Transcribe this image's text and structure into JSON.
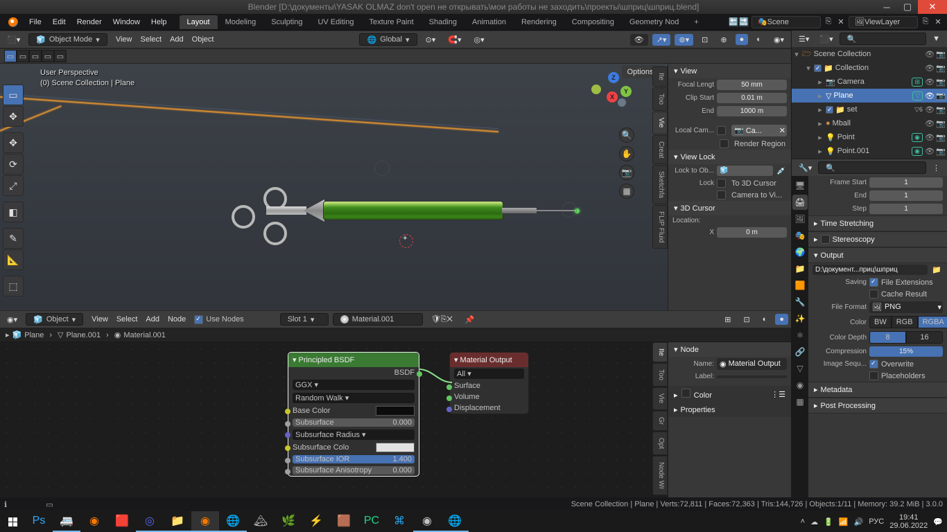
{
  "titlebar": {
    "text": "Blender [D:\\документы\\YASAK OLMAZ don't open не открывать\\мои работы не заходить\\проекты\\шприц\\шприц.blend]"
  },
  "menus": [
    "File",
    "Edit",
    "Render",
    "Window",
    "Help"
  ],
  "workspaces": [
    "Layout",
    "Modeling",
    "Sculpting",
    "UV Editing",
    "Texture Paint",
    "Shading",
    "Animation",
    "Rendering",
    "Compositing",
    "Geometry Nod"
  ],
  "scene_dd": {
    "scene": "Scene",
    "layer": "ViewLayer"
  },
  "viewport": {
    "mode": "Object Mode",
    "menus": [
      "View",
      "Select",
      "Add",
      "Object"
    ],
    "orient": "Global",
    "options": "Options",
    "overlay": {
      "line1": "User Perspective",
      "line2": "(0) Scene Collection | Plane"
    }
  },
  "view_panel": {
    "title": "View",
    "focal": {
      "label": "Focal Lengt",
      "val": "50 mm"
    },
    "clip_start": {
      "label": "Clip Start",
      "val": "0.01 m"
    },
    "clip_end": {
      "label": "End",
      "val": "1000 m"
    },
    "local_cam": {
      "label": "Local Cam...",
      "val": "Ca..."
    },
    "render_region": "Render Region",
    "view_lock": "View Lock",
    "lock_to": {
      "label": "Lock to Ob..."
    },
    "lock": {
      "label": "Lock"
    },
    "to_cursor": "To 3D Cursor",
    "cam_to_view": "Camera to Vi...",
    "cursor3d": "3D Cursor",
    "location": "Location:",
    "x": {
      "label": "X",
      "val": "0 m"
    }
  },
  "vtabs": [
    "Ite",
    "Too",
    "Vie",
    "Creat",
    "Sketchfa",
    "FLIP Fluid"
  ],
  "nodeed": {
    "header": {
      "mode": "Object",
      "menus": [
        "View",
        "Select",
        "Add",
        "Node"
      ],
      "use_nodes": "Use Nodes",
      "slot": "Slot 1",
      "mat": "Material.001"
    },
    "breadcrumb": [
      "Plane",
      "Plane.001",
      "Material.001"
    ],
    "principled": {
      "title": "Principled BSDF",
      "out": "BSDF",
      "dist": "GGX",
      "sss": "Random Walk",
      "basecolor": "Base Color",
      "subsurf": {
        "l": "Subsurface",
        "v": "0.000"
      },
      "ssradius": "Subsurface Radius",
      "sscolor": "Subsurface Colo",
      "ssior": {
        "l": "Subsurface IOR",
        "v": "1.400"
      },
      "ssanis": {
        "l": "Subsurface Anisotropy",
        "v": "0.000"
      }
    },
    "matout": {
      "title": "Material Output",
      "target": "All",
      "surface": "Surface",
      "volume": "Volume",
      "disp": "Displacement"
    }
  },
  "node_sidebar": {
    "title": "Node",
    "name_l": "Name:",
    "name_v": "Material Output",
    "label_l": "Label:",
    "color": "Color",
    "props": "Properties"
  },
  "ntabs": [
    "Ite",
    "Too",
    "Vie",
    "Gr",
    "Opt",
    "Node Wr"
  ],
  "outliner": {
    "items": [
      {
        "name": "Scene Collection",
        "icon": "🗁",
        "depth": 0,
        "exp": true
      },
      {
        "name": "Collection",
        "icon": "📁",
        "depth": 1,
        "exp": true,
        "chk": true
      },
      {
        "name": "Camera",
        "icon": "📷",
        "depth": 2,
        "tag": "⊞",
        "c": "#3dbfa0"
      },
      {
        "name": "Plane",
        "icon": "▽",
        "depth": 2,
        "sel": true,
        "tag": "▽",
        "c": "#3dbfa0"
      },
      {
        "name": "set",
        "icon": "📁",
        "depth": 2,
        "sub": "6",
        "chk": true
      },
      {
        "name": "Mball",
        "icon": "●",
        "depth": 2,
        "ic": "#c98b4a"
      },
      {
        "name": "Point",
        "icon": "💡",
        "depth": 2,
        "tag": "◉",
        "c": "#3dbfa0"
      },
      {
        "name": "Point.001",
        "icon": "💡",
        "depth": 2,
        "tag": "◉",
        "c": "#3dbfa0"
      }
    ]
  },
  "props": {
    "search": "",
    "frame_start": {
      "l": "Frame Start",
      "v": "1"
    },
    "frame_end": {
      "l": "End",
      "v": "1"
    },
    "frame_step": {
      "l": "Step",
      "v": "1"
    },
    "time_stretch": "Time Stretching",
    "stereo": "Stereoscopy",
    "output": "Output",
    "outpath": "D:\\документ...приц\\шприц",
    "saving": {
      "l": "Saving"
    },
    "file_ext": "File Extensions",
    "cache": "Cache Result",
    "file_format": {
      "l": "File Format",
      "v": "PNG"
    },
    "color": {
      "l": "Color",
      "opts": [
        "BW",
        "RGB",
        "RGBA"
      ]
    },
    "depth": {
      "l": "Color Depth",
      "opts": [
        "8",
        "16"
      ]
    },
    "compression": {
      "l": "Compression",
      "v": "15%"
    },
    "img_seq": {
      "l": "Image Sequ..."
    },
    "overwrite": "Overwrite",
    "placeholders": "Placeholders",
    "metadata": "Metadata",
    "postproc": "Post Processing"
  },
  "status": {
    "text": "Scene Collection | Plane | Verts:72,811 | Faces:72,363 | Tris:144,726 | Objects:1/11 | Memory: 39.2 MiB | 3.0.0"
  },
  "taskbar": {
    "lang": "РУС",
    "time": "19:41",
    "date": "29.06.2022"
  }
}
